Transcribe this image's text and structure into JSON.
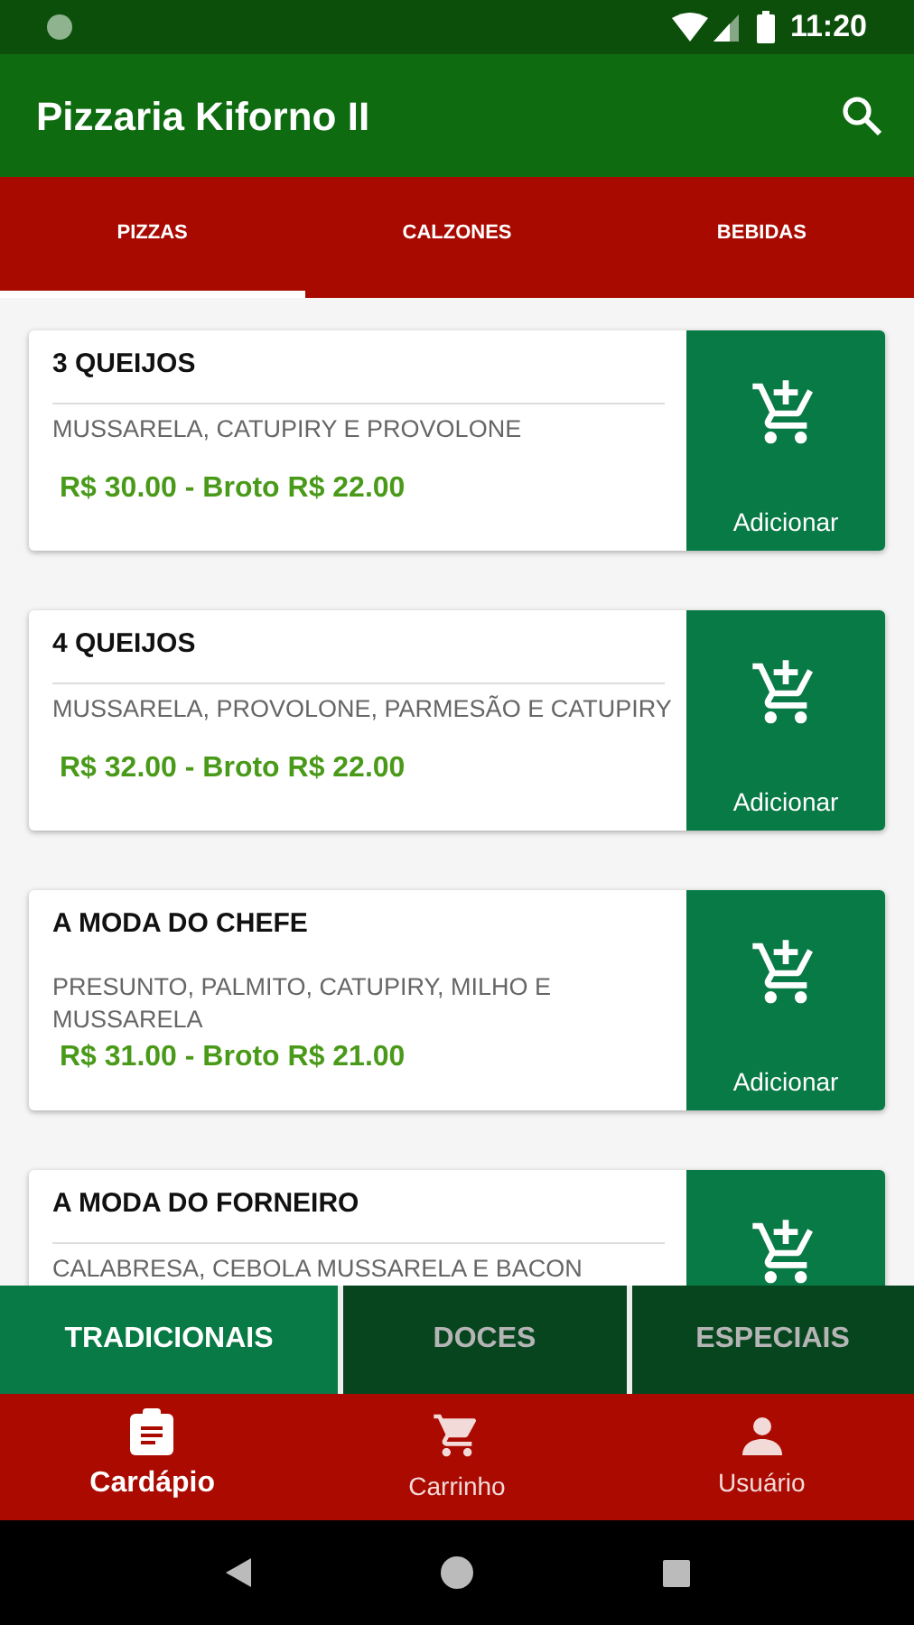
{
  "status_bar": {
    "time": "11:20"
  },
  "app_bar": {
    "title": "Pizzaria Kiforno II"
  },
  "tabs": [
    {
      "label": "PIZZAS",
      "selected": true
    },
    {
      "label": "CALZONES",
      "selected": false
    },
    {
      "label": "BEBIDAS",
      "selected": false
    }
  ],
  "items": [
    {
      "name": "3 QUEIJOS",
      "description": "MUSSARELA, CATUPIRY E PROVOLONE",
      "price": "R$ 30.00 - Broto R$ 22.00",
      "button_label": "Adicionar"
    },
    {
      "name": "4 QUEIJOS",
      "description": "MUSSARELA, PROVOLONE, PARMESÃO E CATUPIRY",
      "price": "R$ 32.00 - Broto R$ 22.00",
      "button_label": "Adicionar"
    },
    {
      "name": "A MODA DO CHEFE",
      "description": "PRESUNTO, PALMITO, CATUPIRY, MILHO E MUSSARELA",
      "price": "R$ 31.00 - Broto R$ 21.00",
      "button_label": "Adicionar"
    },
    {
      "name": "A MODA DO FORNEIRO",
      "description": "CALABRESA, CEBOLA MUSSARELA E BACON"
    }
  ],
  "categories": [
    {
      "label": "TRADICIONAIS",
      "selected": true
    },
    {
      "label": "DOCES",
      "selected": false
    },
    {
      "label": "ESPECIAIS",
      "selected": false
    }
  ],
  "bottom_nav": [
    {
      "kind": "menu",
      "label": "Cardápio",
      "selected": true
    },
    {
      "kind": "cart",
      "label": "Carrinho",
      "selected": false
    },
    {
      "kind": "user",
      "label": "Usuário",
      "selected": false
    }
  ]
}
